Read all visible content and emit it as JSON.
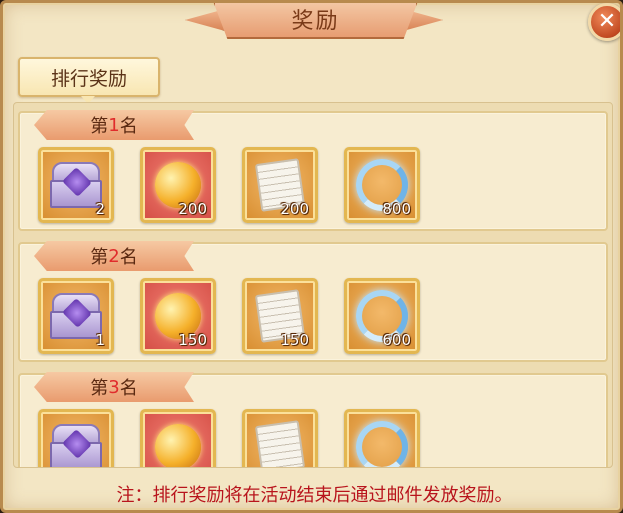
{
  "header": {
    "title": "奖励",
    "close_label": "✕"
  },
  "tabs": [
    {
      "label": "排行奖励",
      "active": true
    }
  ],
  "ranks": [
    {
      "prefix": "第",
      "number": "1",
      "suffix": "名",
      "items": [
        {
          "icon": "treasure-chest-icon",
          "qty": "2"
        },
        {
          "icon": "golden-orb-icon",
          "qty": "200"
        },
        {
          "icon": "scroll-icon",
          "qty": "200"
        },
        {
          "icon": "ice-dragon-icon",
          "qty": "800"
        }
      ]
    },
    {
      "prefix": "第",
      "number": "2",
      "suffix": "名",
      "items": [
        {
          "icon": "treasure-chest-icon",
          "qty": "1"
        },
        {
          "icon": "golden-orb-icon",
          "qty": "150"
        },
        {
          "icon": "scroll-icon",
          "qty": "150"
        },
        {
          "icon": "ice-dragon-icon",
          "qty": "600"
        }
      ]
    },
    {
      "prefix": "第",
      "number": "3",
      "suffix": "名",
      "items": [
        {
          "icon": "treasure-chest-icon",
          "qty": ""
        },
        {
          "icon": "golden-orb-icon",
          "qty": ""
        },
        {
          "icon": "scroll-icon",
          "qty": ""
        },
        {
          "icon": "ice-dragon-icon",
          "qty": ""
        }
      ]
    }
  ],
  "footer": {
    "note": "注：排行奖励将在活动结束后通过邮件发放奖励。"
  },
  "colors": {
    "rank_number": "#e02c2c",
    "footer_text": "#b8141c",
    "panel_bg": "#f3e6c4"
  }
}
